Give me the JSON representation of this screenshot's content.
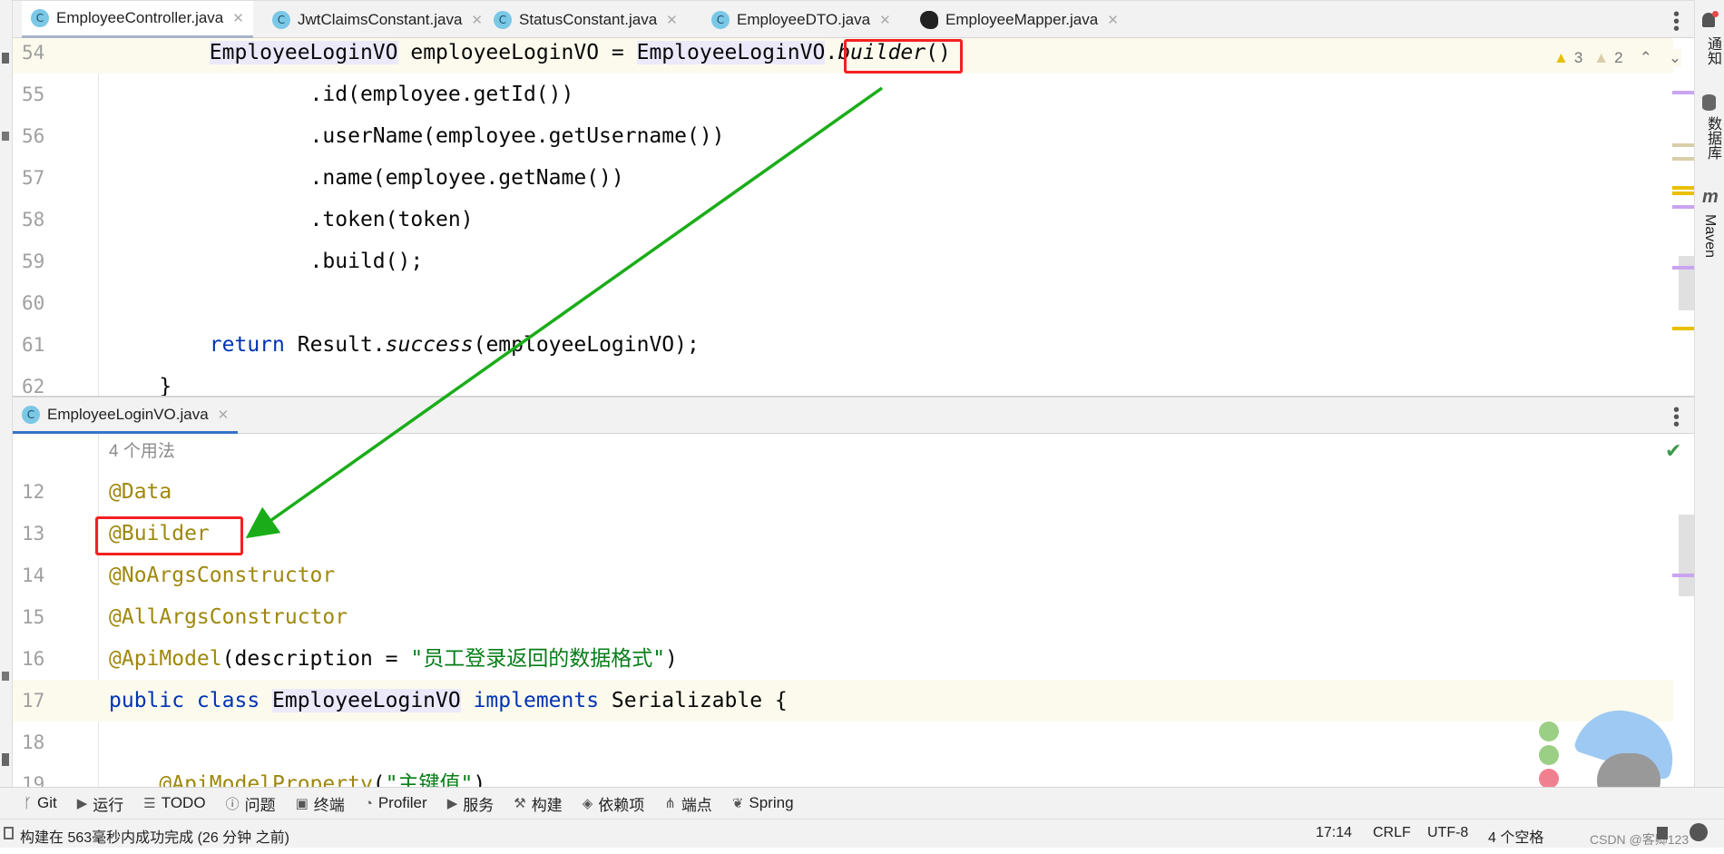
{
  "top_tabs": [
    {
      "label": "EmployeeController.java",
      "icon": "class-icon",
      "active": true
    },
    {
      "label": "JwtClaimsConstant.java",
      "icon": "class-icon"
    },
    {
      "label": "StatusConstant.java",
      "icon": "class-icon"
    },
    {
      "label": "EmployeeDTO.java",
      "icon": "class-icon"
    },
    {
      "label": "EmployeeMapper.java",
      "icon": "mybatis-icon"
    }
  ],
  "close_glyph": "✕",
  "icon_letter": "C",
  "inspections": {
    "warnings": "3",
    "weak_warnings": "2"
  },
  "top_code": [
    {
      "n": "54",
      "cur": true,
      "tokens": [
        [
          "        ",
          "df"
        ],
        [
          "EmployeeLoginVO",
          "df hl"
        ],
        [
          " employeeLoginVO = ",
          "df"
        ],
        [
          "EmployeeLoginVO",
          "df hl"
        ],
        [
          ".",
          "df"
        ],
        [
          "builder",
          "df it"
        ],
        [
          "()",
          "df"
        ]
      ]
    },
    {
      "n": "55",
      "tokens": [
        [
          "                .id(employee.getId())",
          "df"
        ]
      ]
    },
    {
      "n": "56",
      "tokens": [
        [
          "                .userName(employee.getUsername())",
          "df"
        ]
      ]
    },
    {
      "n": "57",
      "tokens": [
        [
          "                .name(employee.getName())",
          "df"
        ]
      ]
    },
    {
      "n": "58",
      "tokens": [
        [
          "                .token(token)",
          "df"
        ]
      ]
    },
    {
      "n": "59",
      "tokens": [
        [
          "                .build();",
          "df"
        ]
      ]
    },
    {
      "n": "60",
      "tokens": []
    },
    {
      "n": "61",
      "tokens": [
        [
          "        ",
          "df"
        ],
        [
          "return",
          "kw"
        ],
        [
          " Result.",
          "df"
        ],
        [
          "success",
          "df it"
        ],
        [
          "(employeeLoginVO);",
          "df"
        ]
      ]
    },
    {
      "n": "62",
      "tokens": [
        [
          "    }",
          "df"
        ]
      ]
    }
  ],
  "bottom_tab": {
    "label": "EmployeeLoginVO.java"
  },
  "usages_hint": "4 个用法",
  "bottom_code": [
    {
      "n": "12",
      "tokens": [
        [
          "@Data",
          "an"
        ]
      ]
    },
    {
      "n": "13",
      "tokens": [
        [
          "@Builder",
          "an"
        ]
      ]
    },
    {
      "n": "14",
      "tokens": [
        [
          "@NoArgsConstructor",
          "an"
        ]
      ]
    },
    {
      "n": "15",
      "tokens": [
        [
          "@AllArgsConstructor",
          "an"
        ]
      ]
    },
    {
      "n": "16",
      "tokens": [
        [
          "@ApiModel",
          "an"
        ],
        [
          "(description = ",
          "df"
        ],
        [
          "\"员工登录返回的数据格式\"",
          "st"
        ],
        [
          ")",
          "df"
        ]
      ]
    },
    {
      "n": "17",
      "cur": true,
      "tokens": [
        [
          "public class ",
          "kw"
        ],
        [
          "EmployeeLoginVO",
          "df hl"
        ],
        [
          " implements ",
          "kw"
        ],
        [
          "Serializable {",
          "df"
        ]
      ]
    },
    {
      "n": "18",
      "tokens": []
    },
    {
      "n": "19",
      "tokens": [
        [
          "    ",
          "df"
        ],
        [
          "@ApiModelProperty",
          "an"
        ],
        [
          "(",
          "df"
        ],
        [
          "\"主键值\"",
          "st"
        ],
        [
          ")",
          "df"
        ]
      ]
    }
  ],
  "right_sidebar": {
    "notifications": "通知",
    "database": "数据库",
    "maven": "Maven"
  },
  "toolbar": [
    {
      "label": "Git",
      "icon": "git-branch-icon",
      "glyph": "ᚴ"
    },
    {
      "label": "运行",
      "icon": "run-icon",
      "glyph": "▶"
    },
    {
      "label": "TODO",
      "icon": "todo-icon",
      "glyph": "☰"
    },
    {
      "label": "问题",
      "icon": "problems-icon",
      "glyph": "ⓘ"
    },
    {
      "label": "终端",
      "icon": "terminal-icon",
      "glyph": "▣"
    },
    {
      "label": "Profiler",
      "icon": "profiler-icon",
      "glyph": "◔"
    },
    {
      "label": "服务",
      "icon": "services-icon",
      "glyph": "▶"
    },
    {
      "label": "构建",
      "icon": "build-hammer-icon",
      "glyph": "⚒"
    },
    {
      "label": "依赖项",
      "icon": "dependencies-icon",
      "glyph": "◈"
    },
    {
      "label": "端点",
      "icon": "endpoints-icon",
      "glyph": "⋔"
    },
    {
      "label": "Spring",
      "icon": "spring-leaf-icon",
      "glyph": "❦"
    }
  ],
  "status": {
    "message": "构建在 563毫秒内成功完成 (26 分钟 之前)",
    "position": "17:14",
    "line_sep": "CRLF",
    "encoding": "UTF-8",
    "indent": "4 个空格"
  },
  "watermark": "CSDN @客卿123",
  "colors": {
    "annotation_box": "#f42020",
    "arrow": "#1aad19",
    "keyword": "#0033b3",
    "annotation": "#9e880d",
    "string": "#067d17"
  }
}
